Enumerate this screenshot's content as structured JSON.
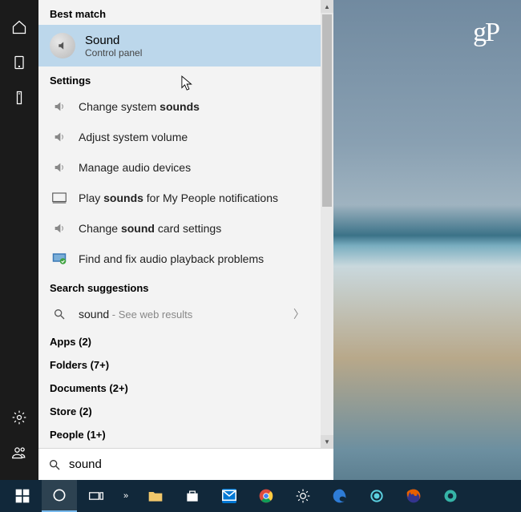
{
  "watermark": "gP",
  "rail": {
    "items": [
      "home",
      "tablet",
      "tower",
      "settings",
      "people"
    ]
  },
  "search": {
    "best_match_header": "Best match",
    "best_match": {
      "title": "Sound",
      "subtitle": "Control panel"
    },
    "settings_header": "Settings",
    "settings_items": [
      {
        "pre": "Change system ",
        "bold": "sounds",
        "post": ""
      },
      {
        "pre": "Adjust system volume",
        "bold": "",
        "post": ""
      },
      {
        "pre": "Manage audio devices",
        "bold": "",
        "post": ""
      },
      {
        "pre": "Play ",
        "bold": "sounds",
        "post": " for My People notifications"
      },
      {
        "pre": "Change ",
        "bold": "sound",
        "post": " card settings"
      },
      {
        "pre": "Find and fix audio playback problems",
        "bold": "",
        "post": ""
      }
    ],
    "suggestions_header": "Search suggestions",
    "web_result": {
      "term": "sound",
      "hint": " - See web results"
    },
    "categories": [
      {
        "label": "Apps",
        "count": "(2)"
      },
      {
        "label": "Folders",
        "count": "(7+)"
      },
      {
        "label": "Documents",
        "count": "(2+)"
      },
      {
        "label": "Store",
        "count": "(2)"
      },
      {
        "label": "People",
        "count": "(1+)"
      }
    ],
    "input_value": "sound"
  },
  "taskbar": {
    "items": [
      "start",
      "cortana",
      "taskview",
      "more",
      "explorer",
      "store",
      "mail",
      "chrome",
      "brightness",
      "edge",
      "groove",
      "firefox",
      "peacock"
    ]
  }
}
